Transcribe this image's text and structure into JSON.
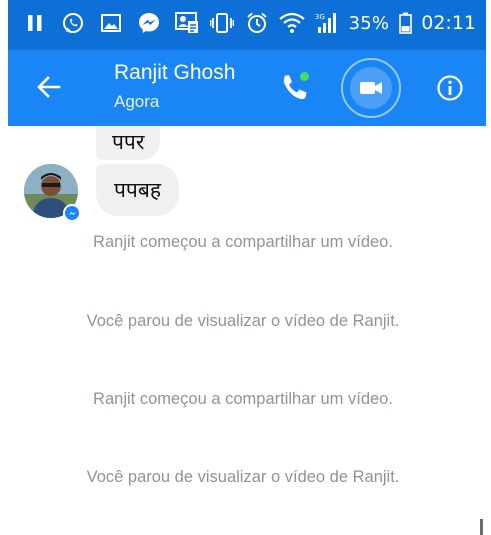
{
  "status_bar": {
    "icons_left": [
      "pause-icon",
      "whatsapp-icon",
      "gallery-icon",
      "messenger-icon",
      "contacts-sync-icon"
    ],
    "icons_right": [
      "vibrate-icon",
      "alarm-icon",
      "wifi-icon",
      "signal-3g-icon"
    ],
    "battery_percent": "35%",
    "time": "02:11"
  },
  "header": {
    "contact_name": "Ranjit Ghosh",
    "contact_status": "Agora",
    "accent_color": "#1a85f5",
    "online_dot_color": "#44e05a"
  },
  "messages": [
    {
      "type": "incoming",
      "text": "पपर"
    },
    {
      "type": "incoming",
      "text": "पपबह"
    }
  ],
  "system_messages": [
    "Ranjit começou a compartilhar um vídeo.",
    "Você parou de visualizar o vídeo de Ranjit.",
    "Ranjit começou a compartilhar um vídeo.",
    "Você parou de visualizar o vídeo de Ranjit."
  ]
}
